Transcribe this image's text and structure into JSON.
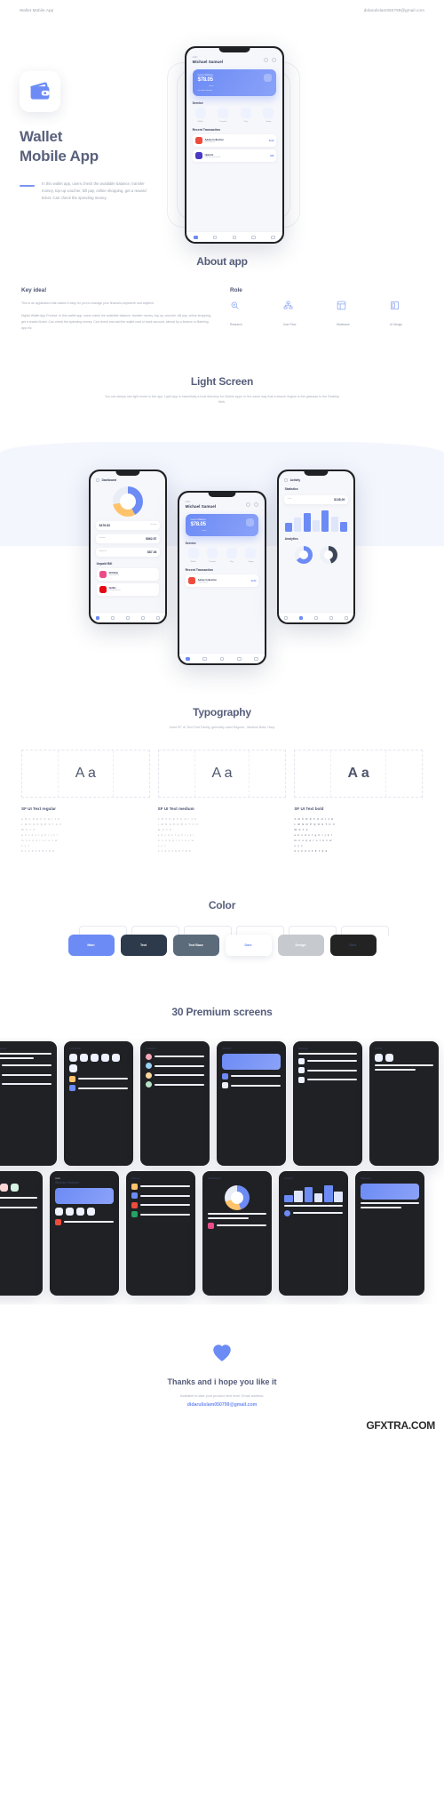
{
  "topbar": {
    "left": "Wallet Mobile App",
    "right": "didarulislam050799@gmail.com"
  },
  "hero": {
    "logo_icon": "wallet-icon",
    "title_line1": "Wallet",
    "title_line2": "Mobile App",
    "description": "In this wallet app, users check the available balance, transfer money, top-up voucher, bill pay, online shopping, get a reward ticket. Can check the spending money."
  },
  "app_screen": {
    "hello": "Hello",
    "name": "Michael Samuel",
    "card_label": "Current Balance",
    "card_amount": "$78.05",
    "card_number": "**** **** **** 1234",
    "card_holder": "Michael Samuel",
    "service_title": "Service",
    "services": [
      {
        "label": "Wallet",
        "icon": "wallet-icon"
      },
      {
        "label": "Transfer",
        "icon": "transfer-icon"
      },
      {
        "label": "Pay",
        "icon": "pay-icon"
      },
      {
        "label": "Topup",
        "icon": "topup-icon"
      }
    ],
    "recent_title": "Recent Transaction",
    "transactions": [
      {
        "name": "Adobe Collection",
        "sub": "Subscription",
        "amount": "$120",
        "color": "#ef4b3c"
      },
      {
        "name": "Upwork",
        "sub": "Payment Received",
        "amount": "$88",
        "color": "#4b39c4"
      }
    ],
    "tabs": [
      "home-icon",
      "card-icon",
      "wallet-icon",
      "heart-icon",
      "profile-icon"
    ]
  },
  "about": {
    "title": "About app",
    "key_idea": {
      "heading": "Key idea!",
      "paragraph_1": "This is an application that makes it easy for you to manage your finances anywhere and anytime.",
      "paragraph_2": "Digital Wallet App Product. In this wallet app, users check the available balance, transfer money, top-up, voucher, bill pay, online shopping, get a reward ticket. Can check the spending money. Can check and add the wallet card or bank account, almost by a finance or Banking app.etc."
    },
    "role": {
      "heading": "Role",
      "items": [
        {
          "label": "Research",
          "icon": "research-icon"
        },
        {
          "label": "User Flow",
          "icon": "user-flow-icon"
        },
        {
          "label": "Wireframe",
          "icon": "wireframe-icon"
        },
        {
          "label": "UI Design",
          "icon": "ui-design-icon"
        }
      ]
    }
  },
  "light_screen": {
    "title": "Light Screen",
    "subtitle": "You can simply use light mode in the app. Light App is essentially a host directory for Mobile apps, in the same way that a search engine is the gateway to the Desktop Web.",
    "dashboard": {
      "back_icon": "back-arrow-icon",
      "title": "Dashboard",
      "amount": "$478.83",
      "legend": [
        "Income",
        "Expense"
      ],
      "stats": [
        {
          "key": "Income",
          "value": "$862.87"
        },
        {
          "key": "Expense",
          "value": "$87.36"
        }
      ],
      "unpaid_title": "Unpaid Bill",
      "bills": [
        {
          "name": "Dribbble",
          "sub": "Subscription",
          "color": "#ea4c89"
        },
        {
          "name": "Netflix",
          "sub": "Entertainment",
          "color": "#e50914"
        }
      ]
    },
    "activity": {
      "back_icon": "back-arrow-icon",
      "title": "Activity",
      "stats_title": "Statistics",
      "chips": [
        "Cost",
        "Income"
      ],
      "amount": "$138.00",
      "analytics_title": "Analytics"
    }
  },
  "typography": {
    "title": "Typography",
    "subtitle": "Used SF UI Text Font Family, generally used Regular , Medium Bold, Havy",
    "sample": "A a",
    "cards": [
      {
        "name": "SF UI Text regular",
        "rows": [
          "A B C D E F G H I J K",
          "L M N O P Q R S T U V",
          "W X Y Z",
          "a b c d e f g h i j k l",
          "m n o p q r s t u v w",
          "x y z",
          "0 1 2 3 4 5 6 7 8 9"
        ]
      },
      {
        "name": "SF UI Text medium",
        "rows": [
          "A B C D E F G H I J K",
          "L M N O P Q R S T U V",
          "W X Y Z",
          "a b c d e f g h i j k l",
          "m n o p q r s t u v w",
          "x y z",
          "0 1 2 3 4 5 6 7 8 9"
        ]
      },
      {
        "name": "SF UI Text bold",
        "rows": [
          "A B C D E F G H I J K",
          "L M N O P Q R S T U V",
          "W X Y Z",
          "a b c d e f g h i j k l",
          "m n o p q r s t u v w",
          "x y z",
          "0 1 2 3 4 5 6 7 8 9"
        ]
      }
    ]
  },
  "color": {
    "title": "Color",
    "swatches": [
      {
        "label": "Main",
        "hex": "#6c8bf5",
        "text": "#ffffff"
      },
      {
        "label": "Text",
        "hex": "#2c3a4b",
        "text": "#ffffff"
      },
      {
        "label": "Text Base",
        "hex": "#5c6b7a",
        "text": "#ffffff"
      },
      {
        "label": "Dark",
        "hex": "#ffffff",
        "text": "#6c8bf5"
      },
      {
        "label": "Design",
        "hex": "#c6cace",
        "text": "#ffffff"
      },
      {
        "label": "Dark",
        "hex": "#232323",
        "text": "#3a4a6b"
      }
    ]
  },
  "premium": {
    "title": "30 Premium screens"
  },
  "footer": {
    "heart_icon": "heart-icon",
    "title": "Thanks and i hope you like it",
    "subtitle": "Available to take your product next level. Email address:",
    "email": "didarulislam050799@gmail.com"
  },
  "watermark": {
    "text": "GFXTRA",
    "suffix": ".COM"
  }
}
